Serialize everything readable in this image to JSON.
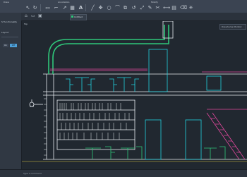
{
  "ribbon": {
    "labels": [
      "Draw",
      "Annotation",
      "Modify"
    ],
    "tools": [
      "pointer-icon",
      "redo-icon",
      "text-icon",
      "mtext-icon",
      "leader-icon",
      "dimension-icon",
      "line-icon",
      "polyline-icon",
      "arc-icon",
      "circle-icon",
      "hatch-icon",
      "move-icon",
      "copy-icon",
      "rotate-icon",
      "trim-icon",
      "erase-icon",
      "scale-icon",
      "stretch-icon",
      "align-icon",
      "explode-icon"
    ]
  },
  "tabs": {
    "drawing_tab": "Untitled"
  },
  "viewport": {
    "label": "Top",
    "view_button": "Drawhome Monitor"
  },
  "sidebar": {
    "line1": "S Functionality",
    "line2": "Layout",
    "btn_left": "On",
    "btn_right": "Off"
  },
  "status": {
    "command_prompt": "Type a command"
  },
  "colors": {
    "cyan": "#22d3df",
    "green": "#2fc77a",
    "magenta": "#e0479c",
    "white": "#e9edf2",
    "yellow": "#e0c640"
  }
}
